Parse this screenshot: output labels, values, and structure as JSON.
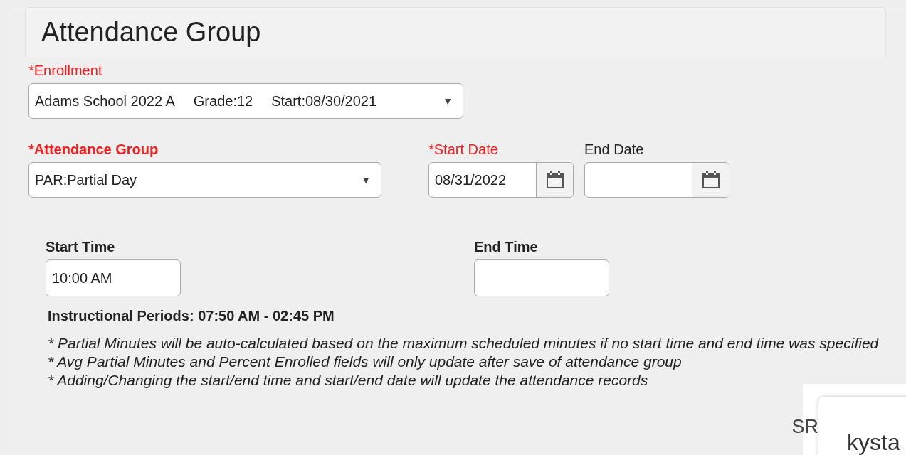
{
  "header": {
    "title": "Attendance Group"
  },
  "enrollment": {
    "label": "*Enrollment",
    "parts": [
      "Adams School 2022 A",
      "Grade:12",
      "Start:08/30/2021"
    ],
    "caret": "▼"
  },
  "attendance_group": {
    "label": "*Attendance Group",
    "value": "PAR:Partial Day",
    "caret": "▼"
  },
  "dates": [
    {
      "label": "*Start Date",
      "required": true,
      "value": "08/31/2022"
    },
    {
      "label": "End Date",
      "required": false
    }
  ],
  "times": [
    {
      "label": "Start Time",
      "value": "10:00 AM"
    },
    {
      "label": "End Time"
    }
  ],
  "instructional_periods": "Instructional Periods: 07:50 AM - 02:45 PM",
  "notes": [
    "* Partial Minutes will be auto-calculated based on the maximum scheduled minutes if no start time and end time was specified",
    "* Avg Partial Minutes and Percent Enrolled fields will only update after save of attendance group",
    "* Adding/Changing the start/end time and start/end date will update the attendance records"
  ],
  "overlay": {
    "side_text": "SR",
    "card_text": "kysta"
  }
}
